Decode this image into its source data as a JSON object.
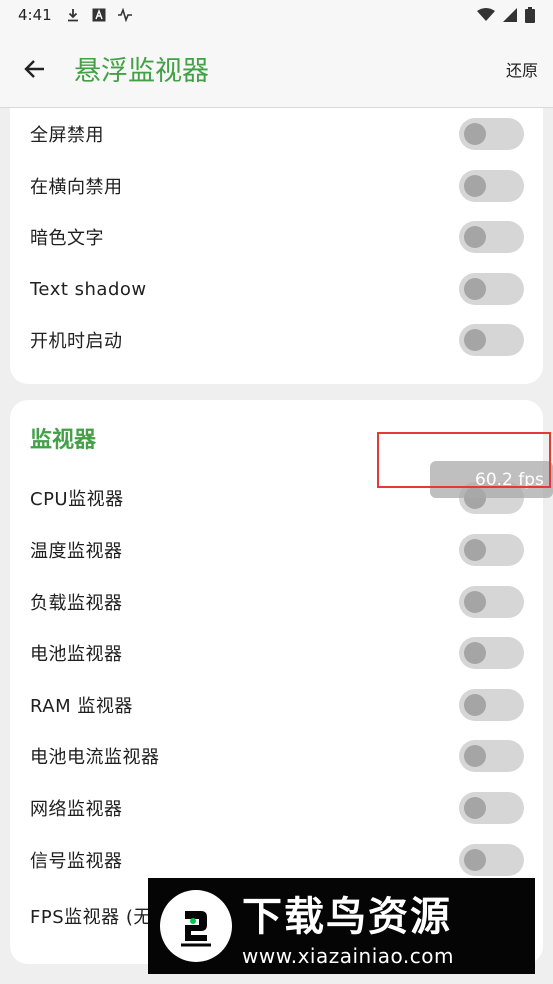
{
  "status_bar": {
    "time": "4:41"
  },
  "app_bar": {
    "title": "悬浮监视器",
    "restore_label": "还原"
  },
  "general_settings": {
    "items": [
      {
        "label": "全屏禁用",
        "enabled": false
      },
      {
        "label": "在横向禁用",
        "enabled": false
      },
      {
        "label": "暗色文字",
        "enabled": false
      },
      {
        "label": "Text shadow",
        "enabled": false
      },
      {
        "label": "开机时启动",
        "enabled": false
      }
    ]
  },
  "monitors": {
    "title": "监视器",
    "items": [
      {
        "label": "CPU监视器",
        "enabled": false
      },
      {
        "label": "温度监视器",
        "enabled": false
      },
      {
        "label": "负载监视器",
        "enabled": false
      },
      {
        "label": "电池监视器",
        "enabled": false
      },
      {
        "label": "RAM 监视器",
        "enabled": false
      },
      {
        "label": "电池电流监视器",
        "enabled": false
      },
      {
        "label": "网络监视器",
        "enabled": false
      },
      {
        "label": "信号监视器",
        "enabled": false
      },
      {
        "label": "FPS监视器 (无",
        "enabled": false
      }
    ]
  },
  "floating_overlay": {
    "fps_text": "60.2 fps"
  },
  "watermark": {
    "title": "下载鸟资源",
    "url": "www.xiazainiao.com"
  },
  "colors": {
    "accent": "#43a047",
    "highlight": "#e53935"
  }
}
